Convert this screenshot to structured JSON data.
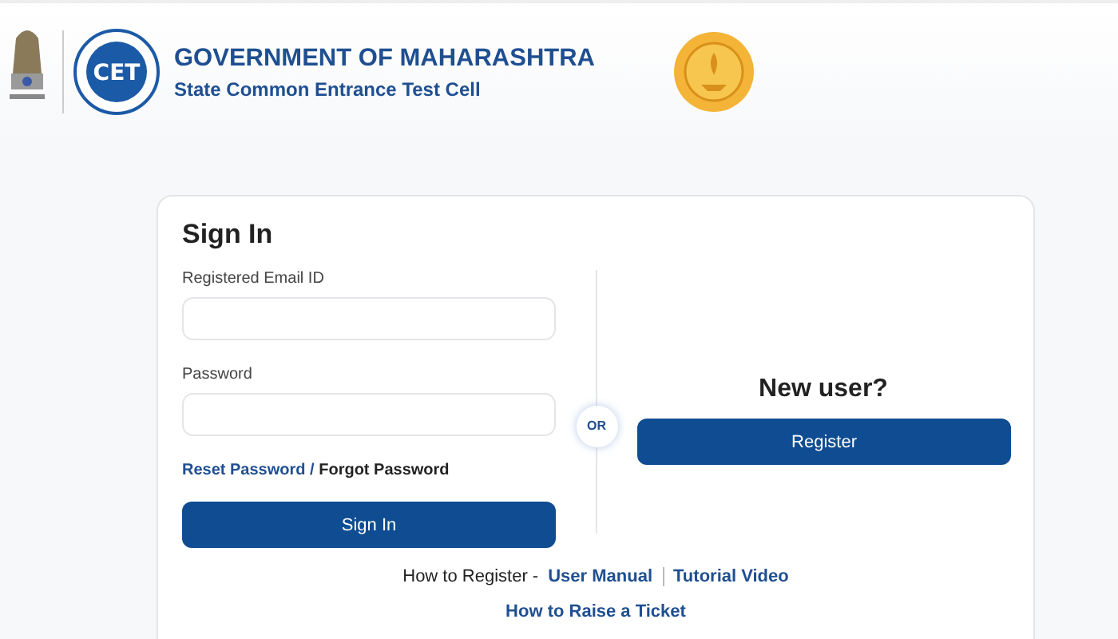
{
  "header": {
    "title": "GOVERNMENT OF MAHARASHTRA",
    "subtitle": "State Common Entrance Test Cell",
    "logo_text": "CET"
  },
  "sign_in": {
    "title": "Sign In",
    "fields": [
      {
        "label": "Registered Email ID"
      },
      {
        "label": "Password"
      }
    ],
    "reset_link": "Reset Password",
    "separator": "/",
    "forgot_text": "Forgot Password",
    "button": "Sign In"
  },
  "divider_badge": "OR",
  "new_user": {
    "title": "New user?",
    "button": "Register"
  },
  "help": {
    "label": "How to Register -",
    "links": [
      "User Manual",
      "Tutorial Video"
    ],
    "ticket_link": "How to Raise a Ticket"
  }
}
